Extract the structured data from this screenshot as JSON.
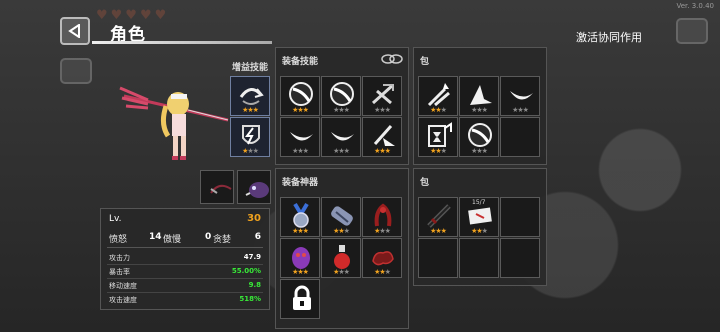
{
  "version": "Ver. 3.0.40",
  "header": {
    "title": "角色",
    "activate_label": "激活协同作用"
  },
  "character": {
    "boost_skill_label": "增益技能",
    "boost_slots": [
      {
        "icon": "swirl-icon",
        "stars": [
          1,
          1,
          1
        ]
      },
      {
        "icon": "lightning-shield-icon",
        "stars": [
          1,
          0,
          0
        ]
      }
    ],
    "mini_slots": [
      {
        "icon": "whip-icon"
      },
      {
        "icon": "boar-icon"
      }
    ]
  },
  "stats": {
    "level_label": "Lv.",
    "level_value": "30",
    "anger_label": "愤怒",
    "anger_value": "14",
    "arrogance_label": "傲慢",
    "arrogance_value": "0",
    "greed_label": "贪婪",
    "greed_value": "6",
    "rows": [
      {
        "label": "攻击力",
        "value": "47.9",
        "color": "#ffffff"
      },
      {
        "label": "暴击率",
        "value": "55.00%",
        "color": "#38e838"
      },
      {
        "label": "移动速度",
        "value": "9.8",
        "color": "#38e838"
      },
      {
        "label": "攻击速度",
        "value": "518%",
        "color": "#38e838"
      }
    ]
  },
  "skills_panel": {
    "title": "装备技能",
    "slots": [
      {
        "icon": "slash-orb-icon",
        "stars": [
          1,
          1,
          1
        ]
      },
      {
        "icon": "slash-orb-icon",
        "stars": [
          0,
          0,
          0
        ]
      },
      {
        "icon": "crossed-blade-icon",
        "stars": [
          0,
          0,
          0
        ]
      },
      {
        "icon": "crescent-icon",
        "stars": [
          0,
          0,
          0
        ]
      },
      {
        "icon": "crescent-icon",
        "stars": [
          0,
          0,
          0
        ]
      },
      {
        "icon": "sword-spark-icon",
        "stars": [
          1,
          1,
          1
        ]
      }
    ]
  },
  "skills_bag": {
    "title": "包",
    "slots": [
      {
        "icon": "rising-sparks-icon",
        "stars": [
          1,
          1,
          0
        ]
      },
      {
        "icon": "blade-wave-icon",
        "stars": [
          0,
          0,
          0
        ]
      },
      {
        "icon": "crescent-icon",
        "stars": [
          0,
          0,
          0
        ]
      },
      {
        "icon": "hourglass-up-icon",
        "stars": [
          1,
          1,
          0
        ]
      },
      {
        "icon": "slash-orb-icon",
        "stars": [
          0,
          0,
          0
        ]
      },
      {
        "icon": "",
        "stars": []
      }
    ]
  },
  "artifacts_panel": {
    "title": "装备神器",
    "slots": [
      {
        "icon": "medal-icon",
        "stars": [
          1,
          1,
          1
        ]
      },
      {
        "icon": "bandage-icon",
        "stars": [
          1,
          1,
          0
        ]
      },
      {
        "icon": "red-tentacle-icon",
        "stars": [
          1,
          0,
          0
        ]
      },
      {
        "icon": "purple-egg-icon",
        "stars": [
          1,
          1,
          1
        ]
      },
      {
        "icon": "potion-icon",
        "stars": [
          1,
          0,
          0
        ]
      },
      {
        "icon": "dark-cloud-icon",
        "stars": [
          1,
          1,
          0
        ]
      },
      {
        "icon": "lock-icon",
        "stars": []
      }
    ]
  },
  "artifacts_bag": {
    "title": "包",
    "slots": [
      {
        "icon": "dark-sword-icon",
        "stars": [
          1,
          1,
          1
        ],
        "badge": ""
      },
      {
        "icon": "ticket-icon",
        "stars": [
          1,
          1,
          0
        ],
        "badge": "15/7"
      },
      {
        "icon": "",
        "stars": [],
        "badge": ""
      },
      {
        "icon": "",
        "stars": [],
        "badge": ""
      },
      {
        "icon": "",
        "stars": [],
        "badge": ""
      },
      {
        "icon": "",
        "stars": [],
        "badge": ""
      }
    ]
  },
  "colors": {
    "star_on": "#f0a21e",
    "star_off": "#8a8a8a",
    "accent_green": "#38e838",
    "level_orange": "#f0a21e"
  }
}
